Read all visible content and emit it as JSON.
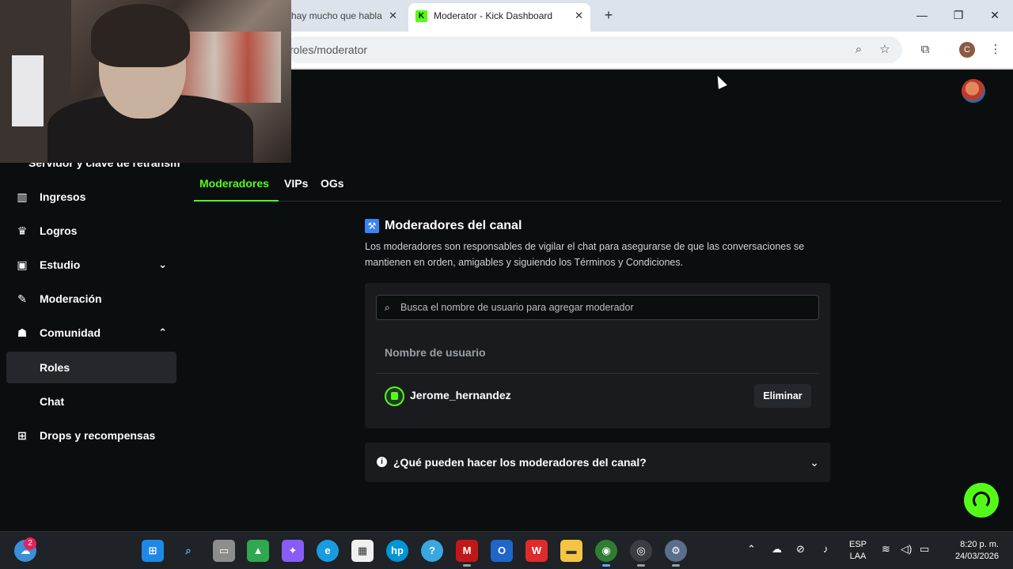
{
  "browser": {
    "inactive_tab_title": "hay mucho que habla",
    "active_tab_title": "Moderator - Kick Dashboard",
    "active_tab_favicon": "K",
    "url": "roles/moderator",
    "profile_initial": "C"
  },
  "sidebar": {
    "partial_item": "Servidor y clave de retransm",
    "items": [
      {
        "label": "Ingresos",
        "icon": "bar-chart-icon"
      },
      {
        "label": "Logros",
        "icon": "trophy-icon"
      },
      {
        "label": "Estudio",
        "icon": "studio-icon",
        "expand": "collapsed"
      },
      {
        "label": "Moderación",
        "icon": "wrench-icon"
      },
      {
        "label": "Comunidad",
        "icon": "users-icon",
        "expand": "expanded"
      },
      {
        "label": "Roles",
        "icon": "",
        "active": true
      },
      {
        "label": "Chat",
        "icon": ""
      },
      {
        "label": "Drops y recompensas",
        "icon": "gift-icon"
      }
    ]
  },
  "tabs": [
    {
      "label": "Moderadores",
      "active": true
    },
    {
      "label": "VIPs",
      "active": false
    },
    {
      "label": "OGs",
      "active": false
    }
  ],
  "section": {
    "title": "Moderadores del canal",
    "description": "Los moderadores son responsables de vigilar el chat para asegurarse de que las conversaciones se mantienen en orden, amigables y siguiendo los Términos y Condiciones."
  },
  "search": {
    "placeholder": "Busca el nombre de usuario para agregar moderador",
    "value": ""
  },
  "table": {
    "column_header": "Nombre de usuario",
    "rows": [
      {
        "username": "Jerome_hernandez",
        "action": "Eliminar"
      }
    ]
  },
  "faq": {
    "label": "¿Qué pueden hacer los moderadores del canal?"
  },
  "taskbar": {
    "widget_badge": "2",
    "language_line1": "ESP",
    "language_line2": "LAA",
    "time": "8:20 p. m.",
    "date": "24/03/2026"
  },
  "colors": {
    "accent": "#53fc18",
    "background": "#0b0e0f",
    "card": "#191b1f"
  }
}
